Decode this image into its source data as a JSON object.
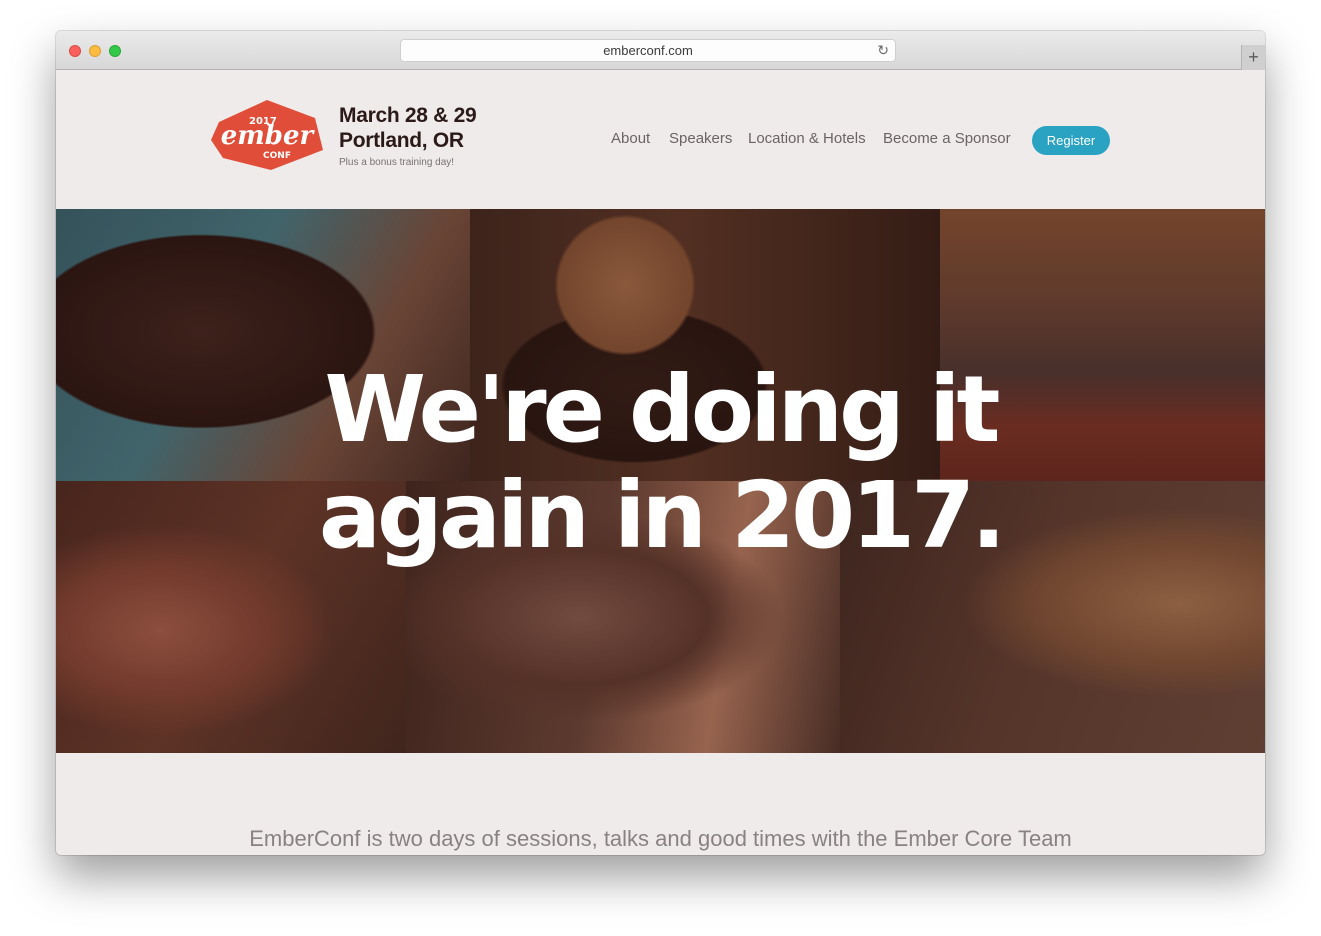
{
  "browser": {
    "url": "emberconf.com",
    "reload_icon": "↻",
    "new_tab_icon": "+"
  },
  "brand": {
    "logo_year": "2017",
    "logo_word": "ember",
    "logo_sub": "CONF",
    "accent_color": "#e04e39"
  },
  "event": {
    "date": "March 28 & 29",
    "place": "Portland, OR",
    "note": "Plus a bonus training day!"
  },
  "nav": {
    "about": "About",
    "speakers": "Speakers",
    "location": "Location & Hotels",
    "sponsor": "Become a Sponsor",
    "register": "Register",
    "register_color": "#2aa3c2"
  },
  "hero": {
    "headline_line1": "We're doing it",
    "headline_line2": "again in 2017."
  },
  "intro": {
    "tagline": "EmberConf is two days of sessions, talks and good times with the Ember Core Team"
  }
}
